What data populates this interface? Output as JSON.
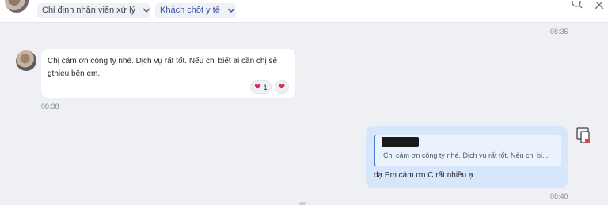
{
  "header": {
    "assignee_dropdown": "Chỉ định nhân viên xử lý",
    "tag_dropdown": "Khách chốt y tế",
    "icons": [
      "chevron-down-icon",
      "search-icon",
      "close-icon"
    ]
  },
  "messages": {
    "top_time": "08:35",
    "incoming": {
      "text": "Chị cám ơn công ty nhé. Dịch vụ rất tốt. Nếu chị biết ai cần chị sẽ gthieu bên em.",
      "reaction_count": "1",
      "time": "08:38"
    },
    "outgoing": {
      "quote_text": "Chị cám ơn công ty nhé. Dịch vụ rất tốt. Nếu chị bi...",
      "text": "dạ Em cảm ơn C rất nhiều ạ",
      "time": "08:40"
    }
  },
  "colors": {
    "background": "#eef0f4",
    "incoming_bubble": "#ffffff",
    "outgoing_bubble": "#d6e6fb",
    "tag_text": "#3e4fa8",
    "heart": "#e0245e"
  }
}
